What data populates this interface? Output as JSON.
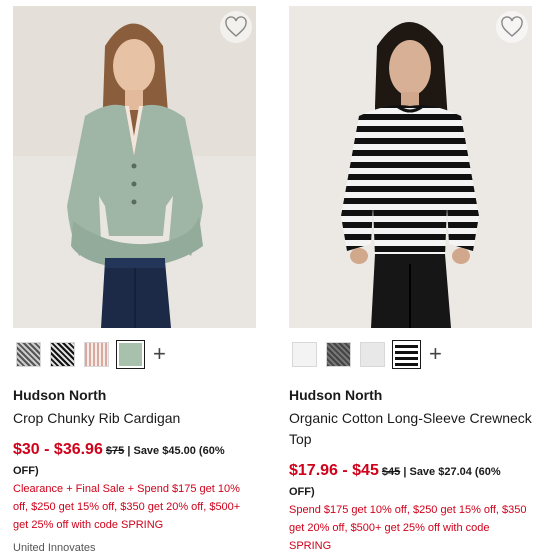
{
  "products": [
    {
      "brand": "Hudson North",
      "name": "Crop Chunky Rib Cardigan",
      "price_range": "$30 - $36.96",
      "was_price": "$75",
      "save_text": "| Save $45.00 (60% OFF)",
      "promo": "Clearance + Final Sale + Spend $175 get 10% off, $250 get 15% off, $350 get 20% off, $500+ get 25% off with code SPRING",
      "partial_text": "United Innovates",
      "swatches": [
        "charcoal-tweed",
        "black-white-tweed",
        "pink-check",
        "sage-green"
      ],
      "selected_swatch": 3,
      "favorite_icon": "heart-outline-icon",
      "more_colors_icon": "plus-icon"
    },
    {
      "brand": "Hudson North",
      "name": "Organic Cotton Long-Sleeve Crewneck Top",
      "price_range": "$17.96 - $45",
      "was_price": "$45",
      "save_text": "| Save $27.04 (60% OFF)",
      "promo": "Spend $175 get 10% off, $250 get 15% off, $350 get 20% off, $500+ get 25% off with code SPRING",
      "swatches": [
        "white",
        "charcoal-heather",
        "light-grey",
        "black-white-stripe"
      ],
      "selected_swatch": 3,
      "favorite_icon": "heart-outline-icon",
      "more_colors_icon": "plus-icon"
    }
  ],
  "colors": {
    "sale_red": "#d0021b",
    "text": "#1a1a1a"
  }
}
